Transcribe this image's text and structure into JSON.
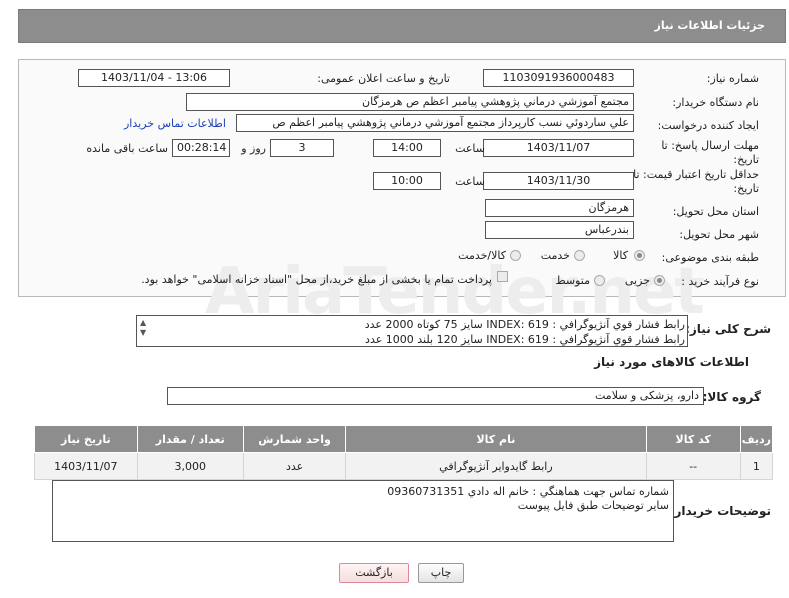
{
  "header": {
    "title": "جزئیات اطلاعات نیاز"
  },
  "fields": {
    "need_number_label": "شماره نیاز:",
    "need_number": "1103091936000483",
    "announce_label": "تاریخ و ساعت اعلان عمومی:",
    "announce_value": "1403/11/04 - 13:06",
    "buyer_org_label": "نام دستگاه خریدار:",
    "buyer_org": "مجتمع آموزشي درماني پژوهشي پيامبر اعظم ص  هرمزگان",
    "creator_label": "ایجاد کننده درخواست:",
    "creator": "علي ساردوئي نسب کارپرداز مجتمع آموزشي درماني پژوهشي پيامبر اعظم ص",
    "contact_link": "اطلاعات تماس خریدار",
    "send_deadline_label": "مهلت ارسال پاسخ: تا",
    "send_deadline_label2": "تاریخ:",
    "send_date": "1403/11/07",
    "time_label": "ساعت",
    "send_time": "14:00",
    "days_value": "3",
    "days_label": "روز و",
    "remaining_value": "00:28:14",
    "remaining_label": "ساعت باقی مانده",
    "validity_label": "حداقل تاریخ اعتبار قیمت: تا",
    "validity_label2": "تاریخ:",
    "validity_date": "1403/11/30",
    "validity_time": "10:00",
    "province_label": "استان محل تحویل:",
    "province": "هرمزگان",
    "city_label": "شهر محل تحویل:",
    "city": "بندرعباس",
    "category_label": "طبقه بندی موضوعی:",
    "category_options": [
      "کالا",
      "خدمت",
      "کالا/خدمت"
    ],
    "process_label": "نوع فرآیند خرید :",
    "process_options": [
      "جزیی",
      "متوسط"
    ],
    "payment_note": "پرداخت تمام یا بخشی از مبلغ خرید،از محل \"اسناد خزانه اسلامی\" خواهد بود."
  },
  "summary": {
    "label": "شرح کلی نیاز:",
    "lines": [
      "رابط فشار قوي آنژيوگرافي : INDEX: 619 سايز 75 کوتاه     2000 عدد",
      "رابط فشار قوي آنژيوگرافي : INDEX: 619 سايز 120 بلند     1000 عدد"
    ]
  },
  "goods": {
    "section_title": "اطلاعات کالاهای مورد نیاز",
    "group_label": "گروه کالا:",
    "group_value": "دارو، پزشکی و سلامت",
    "columns": [
      "ردیف",
      "کد کالا",
      "نام کالا",
      "واحد شمارش",
      "تعداد / مقدار",
      "تاریخ نیاز"
    ],
    "rows": [
      {
        "row": "1",
        "code": "--",
        "name": "رابط گايدواير آنژيوگرافي",
        "unit": "عدد",
        "qty": "3,000",
        "date": "1403/11/07"
      }
    ]
  },
  "buyer_notes": {
    "label": "توضیحات خریدار:",
    "lines": [
      "شماره تماس جهت هماهنگي : خانم اله دادي 09360731351",
      "ساير توضيحات طبق فايل پيوست"
    ]
  },
  "buttons": {
    "print": "چاپ",
    "back": "بازگشت"
  },
  "watermark": "AriaTender.net"
}
